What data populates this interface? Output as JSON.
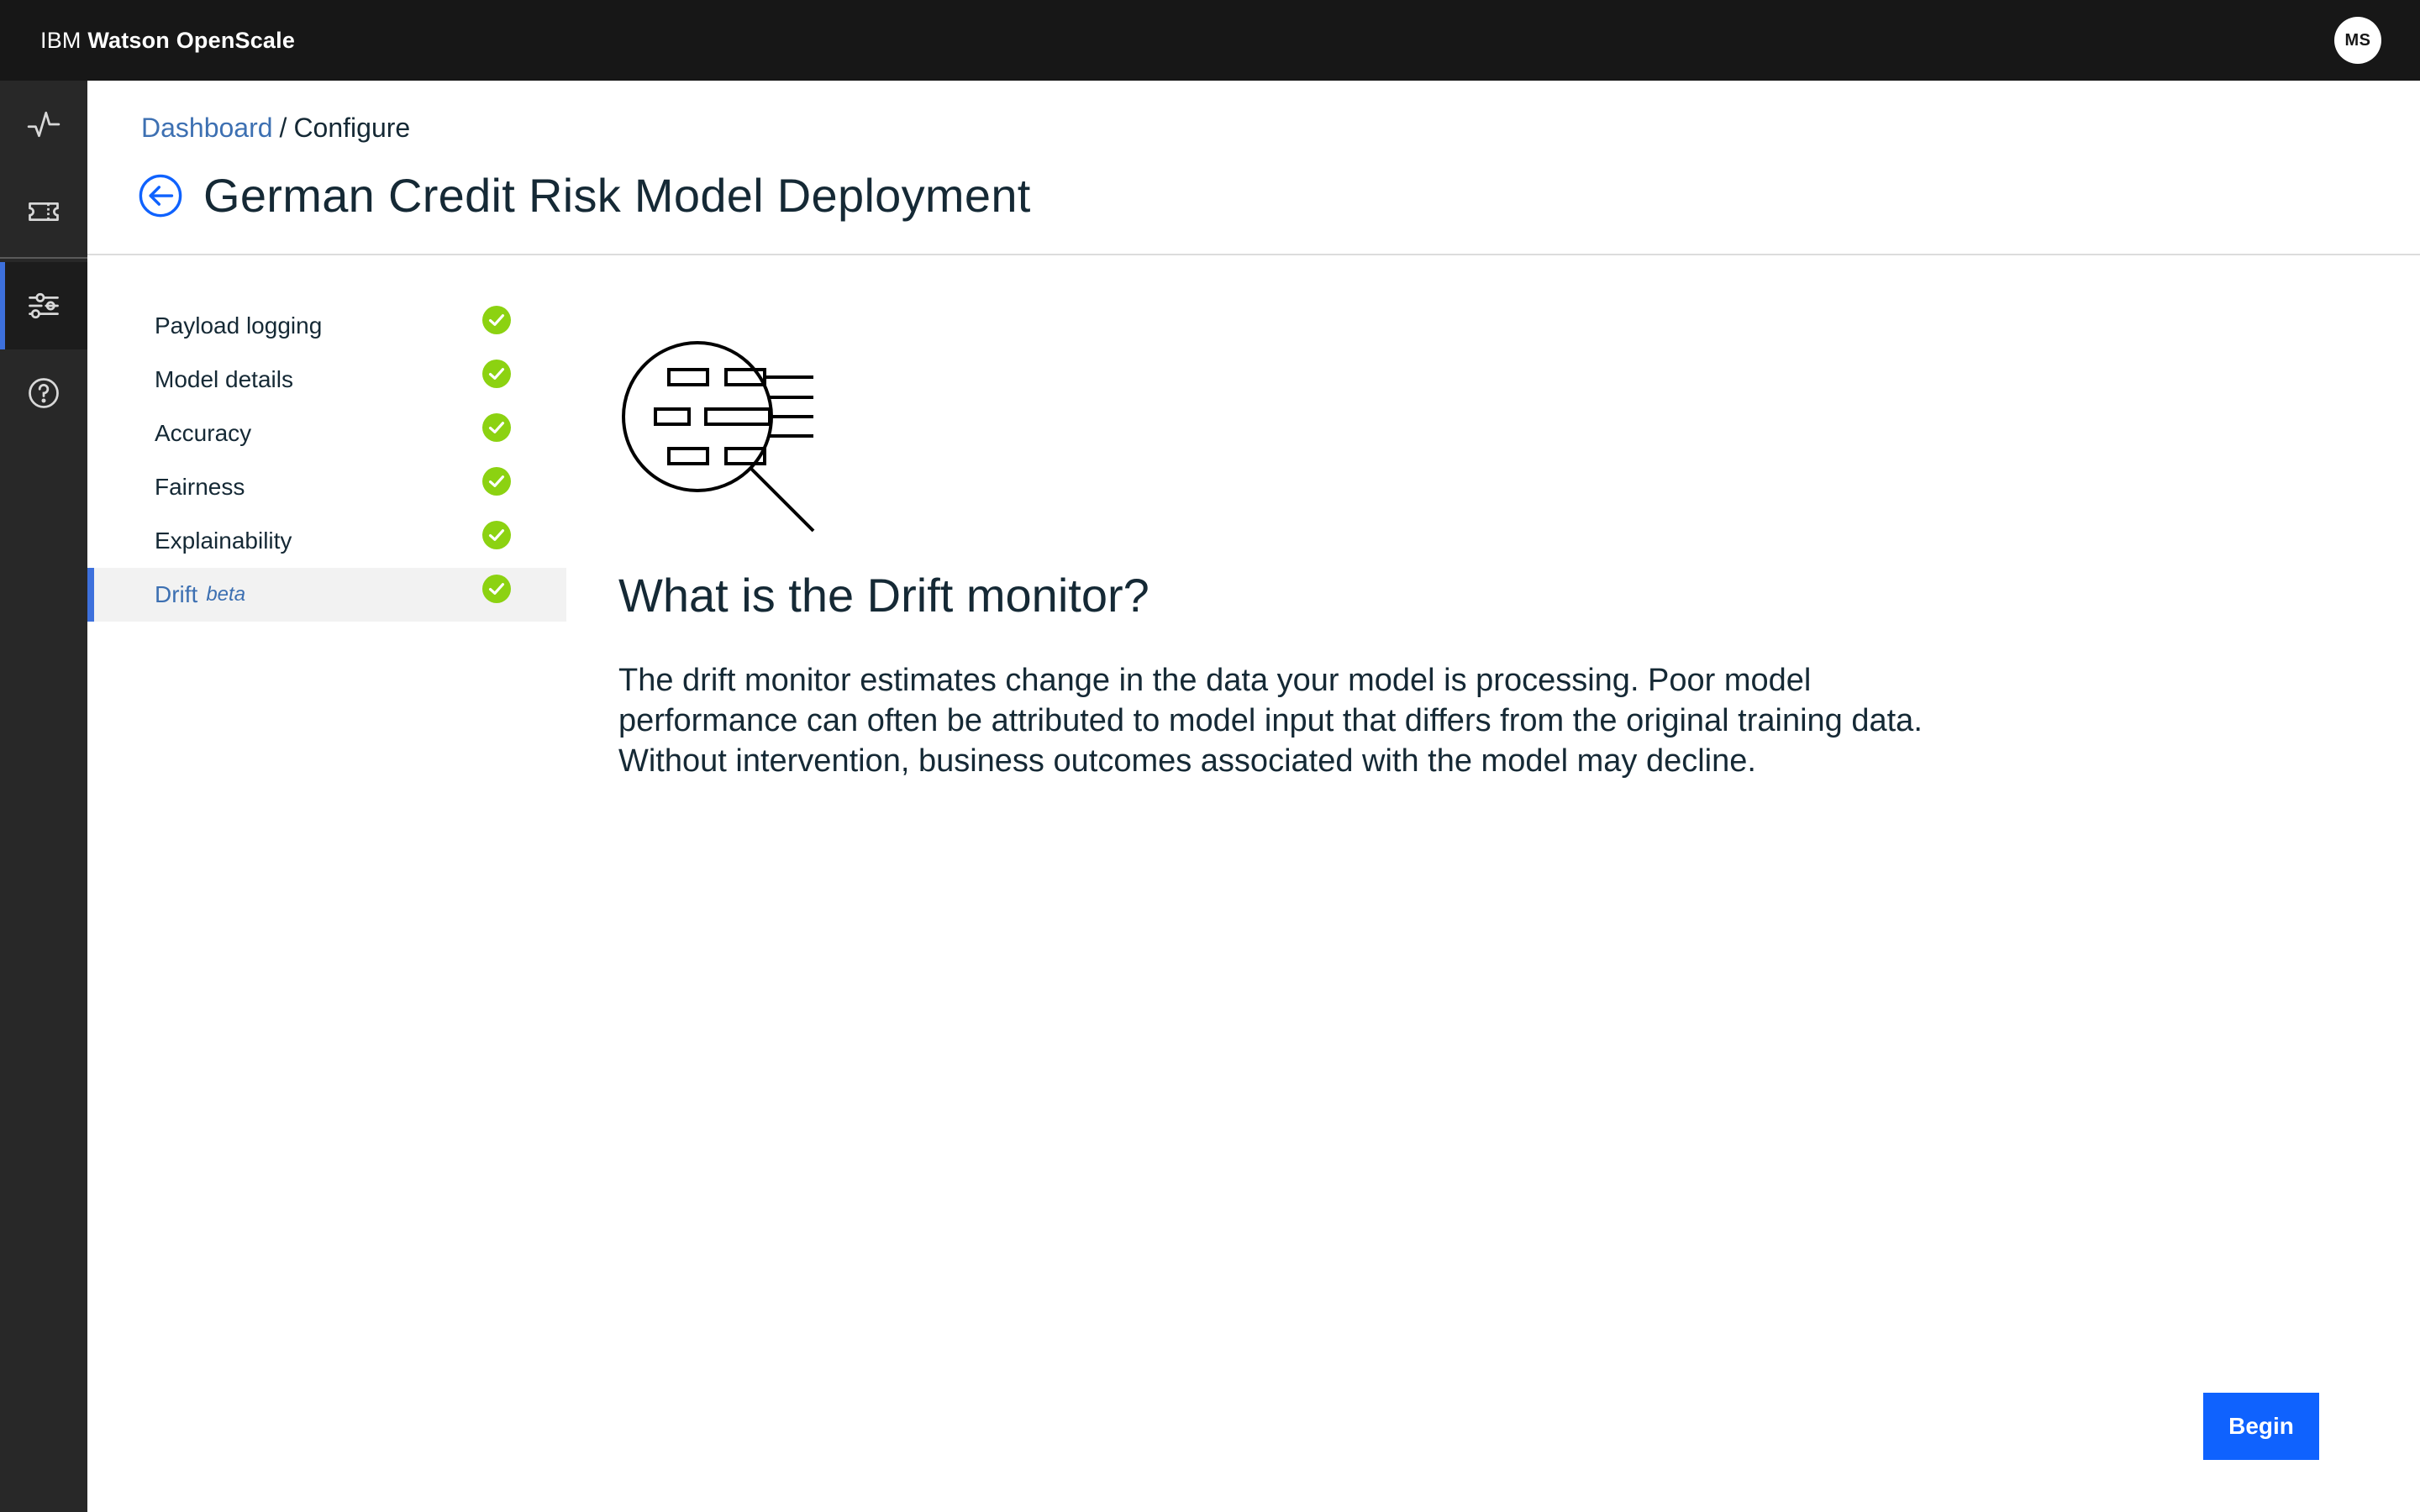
{
  "header": {
    "brand_prefix": "IBM",
    "brand_name": "Watson OpenScale",
    "avatar_initials": "MS"
  },
  "rail": {
    "items": [
      {
        "icon": "activity-icon",
        "active": false
      },
      {
        "icon": "ticket-icon",
        "active": false
      },
      {
        "icon": "settings-sliders-icon",
        "active": true
      },
      {
        "icon": "help-icon",
        "active": false
      }
    ]
  },
  "breadcrumb": {
    "link": "Dashboard",
    "separator": "/",
    "current": "Configure"
  },
  "page": {
    "title": "German Credit Risk Model Deployment",
    "back_icon": "arrow-left-circle-icon"
  },
  "steps": [
    {
      "label": "Payload logging",
      "complete": true
    },
    {
      "label": "Model details",
      "complete": true
    },
    {
      "label": "Accuracy",
      "complete": true
    },
    {
      "label": "Fairness",
      "complete": true
    },
    {
      "label": "Explainability",
      "complete": true
    },
    {
      "label": "Drift",
      "tag": "beta",
      "complete": true,
      "active": true
    }
  ],
  "main": {
    "illustration_icon": "magnifier-data-icon",
    "heading": "What is the Drift monitor?",
    "body": "The drift monitor estimates change in the data your model is processing. Poor model performance can often be attributed to model input that differs from the original training data. Without intervention, business outcomes associated with the model may decline.",
    "begin_label": "Begin"
  },
  "colors": {
    "topbar": "#171717",
    "rail": "#282828",
    "accent": "#3d70dc",
    "link": "#3d70b2",
    "success": "#8cd211",
    "primary_button": "#0f62fe"
  }
}
